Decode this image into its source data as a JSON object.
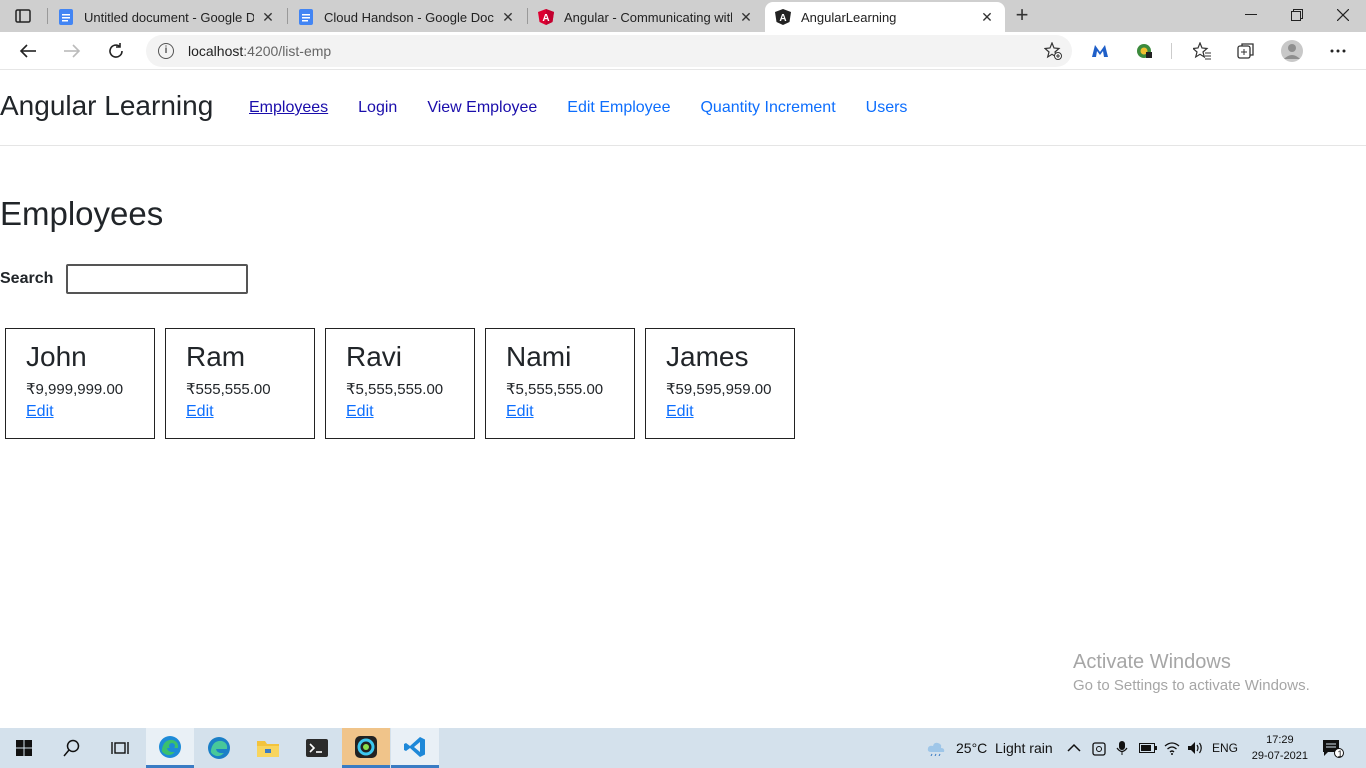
{
  "browser": {
    "tabs": [
      {
        "title": "Untitled document - Google Doc",
        "icon": "google-docs-icon"
      },
      {
        "title": "Cloud Handson - Google Docs",
        "icon": "google-docs-icon"
      },
      {
        "title": "Angular - Communicating with b",
        "icon": "angular-icon"
      },
      {
        "title": "AngularLearning",
        "icon": "angular-app-icon",
        "active": true
      }
    ],
    "url_host": "localhost",
    "url_path": ":4200/list-emp"
  },
  "app": {
    "brand": "Angular Learning",
    "nav": [
      {
        "label": "Employees"
      },
      {
        "label": "Login"
      },
      {
        "label": "View Employee"
      },
      {
        "label": "Edit Employee"
      },
      {
        "label": "Quantity Increment"
      },
      {
        "label": "Users"
      }
    ],
    "page_title": "Employees",
    "search_label": "Search",
    "search_value": "",
    "employees": [
      {
        "name": "John",
        "salary": "₹9,999,999.00",
        "edit_label": "Edit"
      },
      {
        "name": "Ram",
        "salary": "₹555,555.00",
        "edit_label": "Edit"
      },
      {
        "name": "Ravi",
        "salary": "₹5,555,555.00",
        "edit_label": "Edit"
      },
      {
        "name": "Nami",
        "salary": "₹5,555,555.00",
        "edit_label": "Edit"
      },
      {
        "name": "James",
        "salary": "₹59,595,959.00",
        "edit_label": "Edit"
      }
    ]
  },
  "watermark": {
    "title": "Activate Windows",
    "subtitle": "Go to Settings to activate Windows."
  },
  "taskbar": {
    "weather": "25°C  Light rain",
    "language": "ENG",
    "time": "17:29",
    "date": "29-07-2021",
    "notification_count": "1"
  },
  "colors": {
    "link": "#0d6efd",
    "visited_link": "#1a0dab",
    "taskbar": "#d4e1ec"
  }
}
